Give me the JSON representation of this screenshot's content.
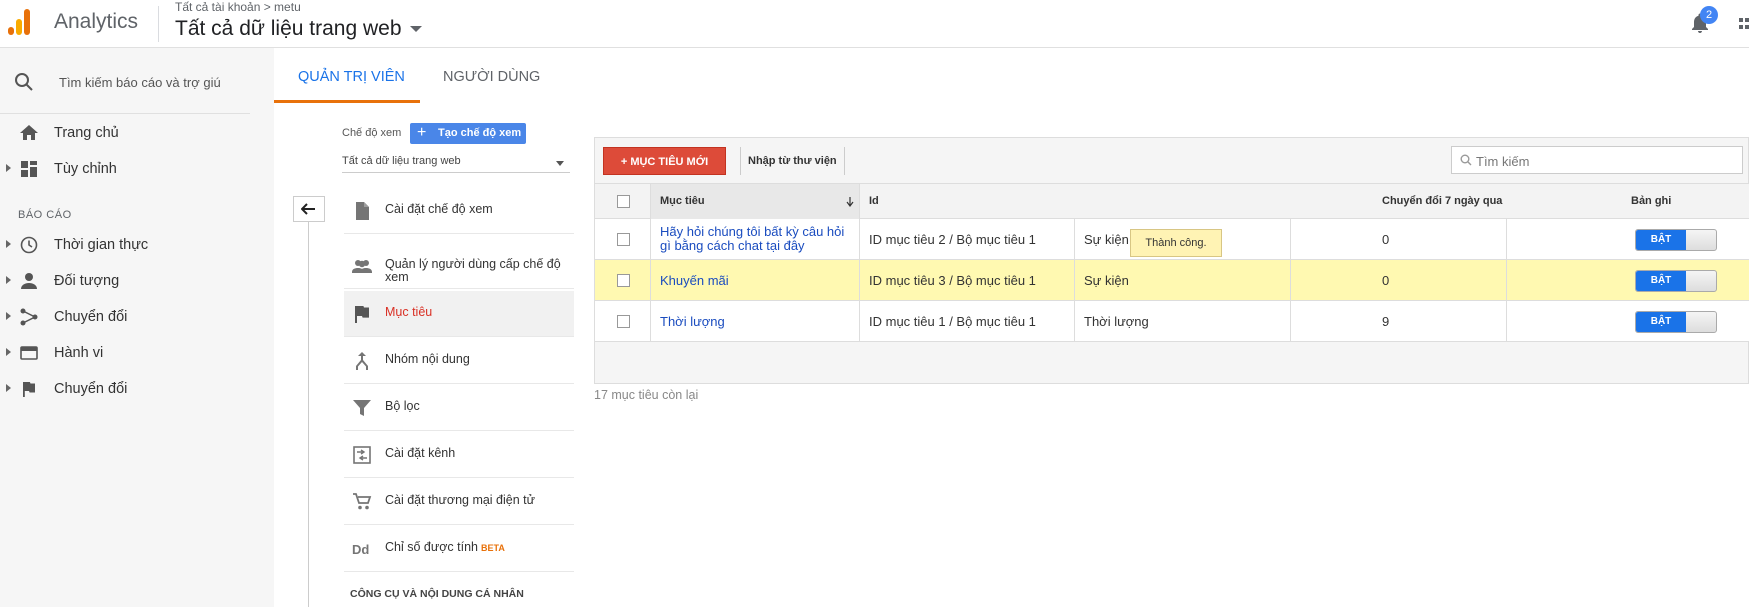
{
  "header": {
    "app_title": "Analytics",
    "breadcrumb": "Tất cả tài khoản > metu",
    "property": "Tất cả dữ liệu trang web",
    "notification_count": "2"
  },
  "sidebar": {
    "search_placeholder": "Tìm kiếm báo cáo và trợ giú",
    "items": [
      {
        "label": "Trang chủ",
        "icon": "home-icon"
      },
      {
        "label": "Tùy chỉnh",
        "icon": "dashboard-icon"
      },
      {
        "label": "Thời gian thực",
        "icon": "clock-icon"
      },
      {
        "label": "Đối tượng",
        "icon": "person-icon"
      },
      {
        "label": "Chuyển đổi",
        "icon": "acquisition-icon"
      },
      {
        "label": "Hành vi",
        "icon": "behavior-icon"
      },
      {
        "label": "Chuyển đổi",
        "icon": "flag-icon"
      }
    ],
    "section_reports": "BÁO CÁO"
  },
  "tabs": {
    "admin": "QUẢN TRỊ VIÊN",
    "users": "NGƯỜI DÙNG"
  },
  "view_panel": {
    "view_label": "Chế độ xem",
    "create_view": "Tạo chế độ xem",
    "selected_view": "Tất cả dữ liệu trang web",
    "menu": [
      {
        "label": "Cài đặt chế độ xem",
        "icon": "document-icon"
      },
      {
        "label": "Quản lý người dùng cấp chế độ xem",
        "icon": "people-icon"
      },
      {
        "label": "Mục tiêu",
        "icon": "flag-icon"
      },
      {
        "label": "Nhóm nội dung",
        "icon": "content-group-icon"
      },
      {
        "label": "Bộ lọc",
        "icon": "filter-icon"
      },
      {
        "label": "Cài đặt kênh",
        "icon": "channel-icon"
      },
      {
        "label": "Cài đặt thương mại điện tử",
        "icon": "cart-icon"
      },
      {
        "label": "Chỉ số được tính",
        "icon": "dd-icon"
      }
    ],
    "beta_label": "BETA",
    "personal_tools": "CÔNG CỤ VÀ NỘI DUNG CÁ NHÂN"
  },
  "goals": {
    "new_goal": "+ MỤC TIÊU MỚI",
    "import": "Nhập từ thư viện",
    "search_placeholder": "Tìm kiếm",
    "columns": [
      "Mục tiêu",
      "Id",
      "Chuyển đổi 7 ngày qua",
      "Bản ghi"
    ],
    "tooltip": "Thành công.",
    "rows": [
      {
        "name": "Hãy hỏi chúng tôi bất kỳ câu hỏi gì bằng cách chat tại đây",
        "id": "ID mục tiêu 2 / Bộ mục tiêu 1",
        "type": "Sự kiện",
        "conversions": "0",
        "status": "BẬT"
      },
      {
        "name": "Khuyến mãi",
        "id": "ID mục tiêu 3 / Bộ mục tiêu 1",
        "type": "Sự kiện",
        "conversions": "0",
        "status": "BẬT"
      },
      {
        "name": "Thời lượng",
        "id": "ID mục tiêu 1 / Bộ mục tiêu 1",
        "type": "Thời lượng",
        "conversions": "9",
        "status": "BẬT"
      }
    ],
    "remaining": "17 mục tiêu còn lại"
  },
  "colors": {
    "accent": "#1a73e8",
    "new_goal_btn": "#dd4b39",
    "highlight_row": "#fff9b1",
    "tab_underline": "#e8710a"
  }
}
